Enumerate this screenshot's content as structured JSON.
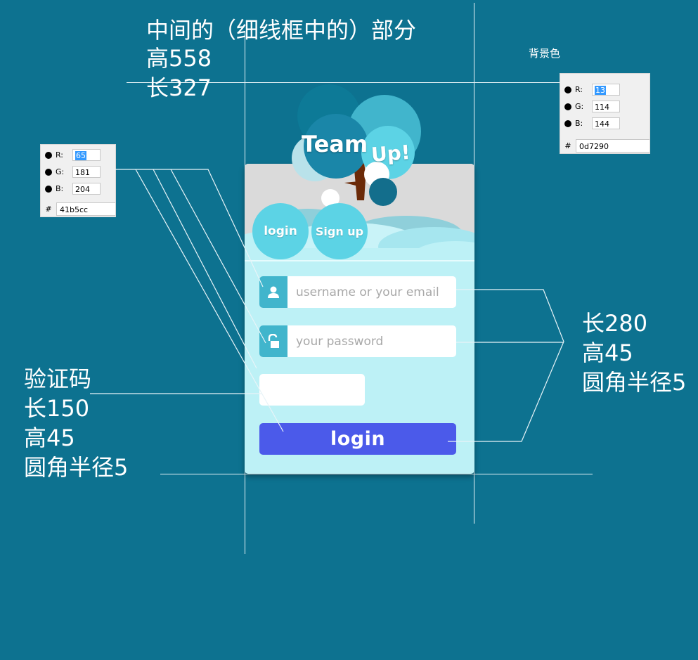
{
  "annotations": {
    "main_title": "中间的（细线框中的）部分",
    "main_height": "高558",
    "main_width": "长327",
    "background_label": "背景色",
    "input_width": "长280",
    "input_height": "高45",
    "input_radius": "圆角半径5",
    "captcha_title": "验证码",
    "captcha_width": "长150",
    "captcha_height": "高45",
    "captcha_radius": "圆角半径5"
  },
  "swatch_bg": {
    "r_label": "R:",
    "g_label": "G:",
    "b_label": "B:",
    "hash": "#",
    "r": "13",
    "g": "114",
    "b": "144",
    "hex": "0d7290"
  },
  "swatch_accent": {
    "r_label": "R:",
    "g_label": "G:",
    "b_label": "B:",
    "hash": "#",
    "r": "65",
    "g": "181",
    "b": "204",
    "hex": "41b5cc"
  },
  "form": {
    "logo_team": "Team",
    "logo_up": "Up!",
    "tab_login": "login",
    "tab_signup": "Sign up",
    "username_placeholder": "username or your email",
    "password_placeholder": "your password",
    "login_button": "login"
  },
  "colors": {
    "background": "#0d7290",
    "accent": "#41b5cc",
    "button": "#4b5aea",
    "form_bg": "#bdf1f6"
  }
}
